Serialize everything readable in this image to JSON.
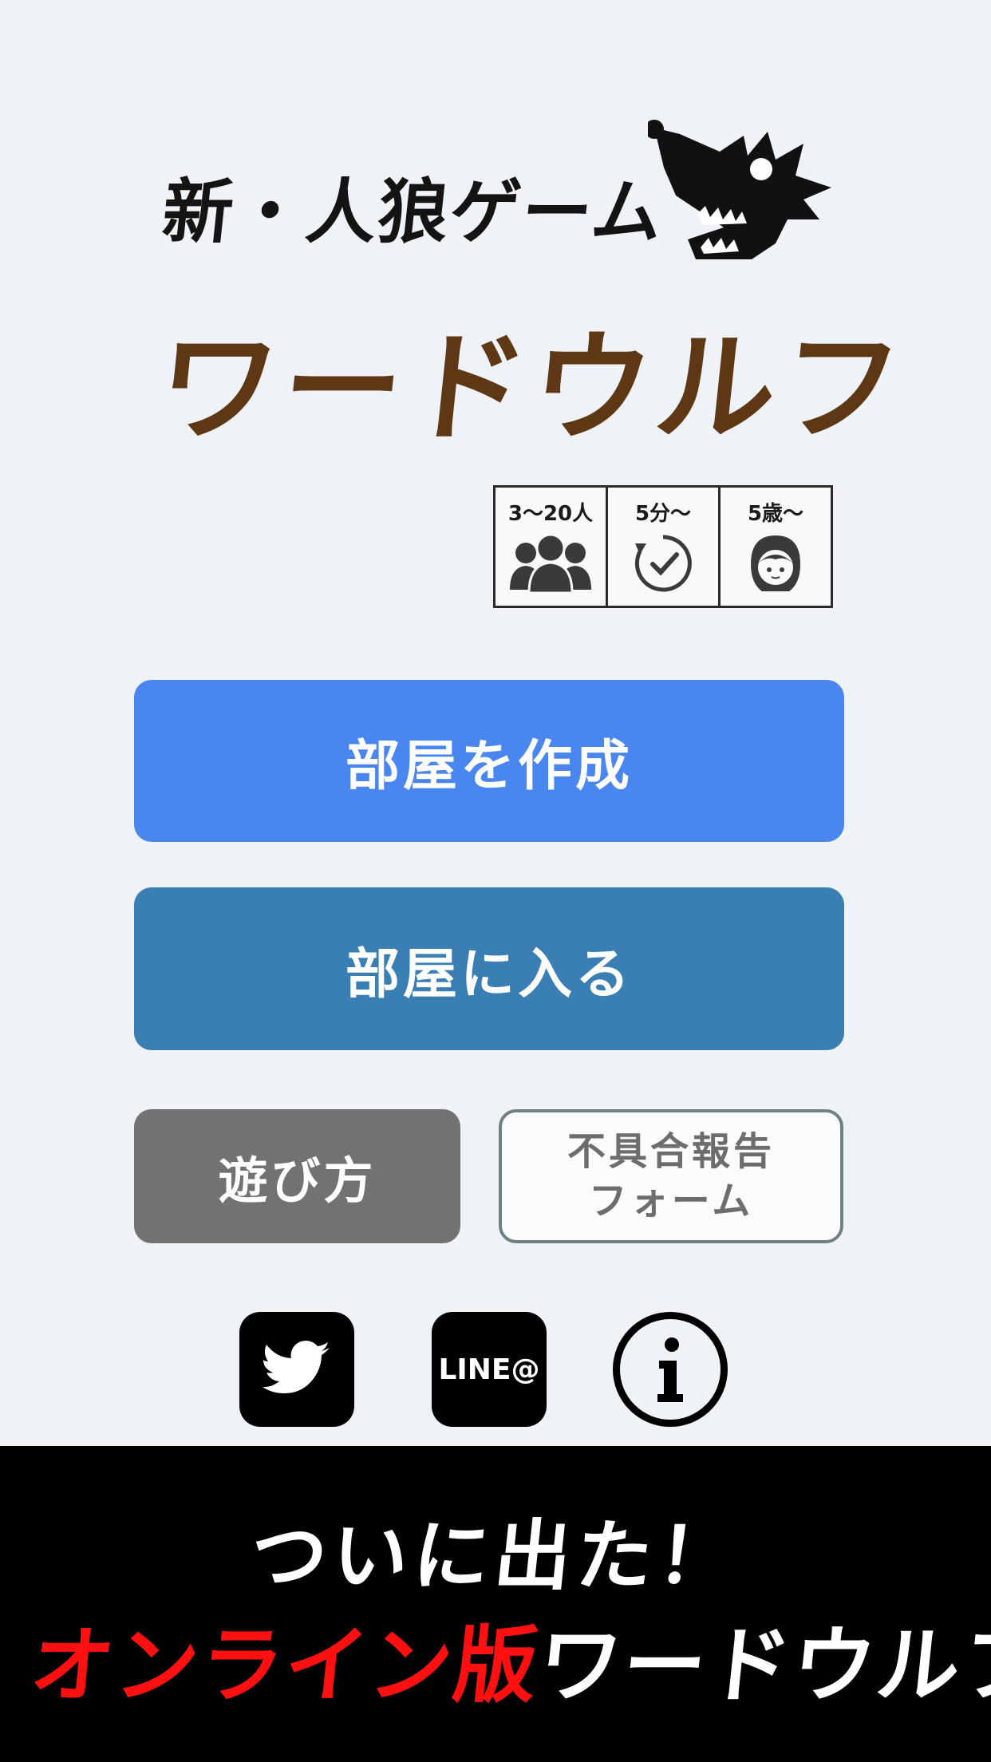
{
  "header": {
    "subtitle": "新・人狼ゲーム",
    "title": "ワードウルフ",
    "logo_icon": "wolf-head-icon",
    "title_color": "#5e3714"
  },
  "info_badges": [
    {
      "label": "3〜20人",
      "icon": "people-icon"
    },
    {
      "label": "5分〜",
      "icon": "clock-icon"
    },
    {
      "label": "5歳〜",
      "icon": "child-icon"
    }
  ],
  "buttons": {
    "create_room": "部屋を作成",
    "join_room": "部屋に入る",
    "how_to_play": "遊び方",
    "report_line1": "不具合報告",
    "report_line2": "フォーム"
  },
  "social": {
    "twitter_icon": "twitter-bird-icon",
    "line_label": "LINE@",
    "info_icon": "info-icon"
  },
  "banner": {
    "line1": "ついに出た！",
    "line2_red": "オンライン版",
    "line2_white": "ワードウルフ！"
  },
  "colors": {
    "background": "#eff3f8",
    "create_button": "#4a86f0",
    "join_button": "#3a7fb4",
    "howto_button": "#727272",
    "banner_red": "#ff1010"
  }
}
